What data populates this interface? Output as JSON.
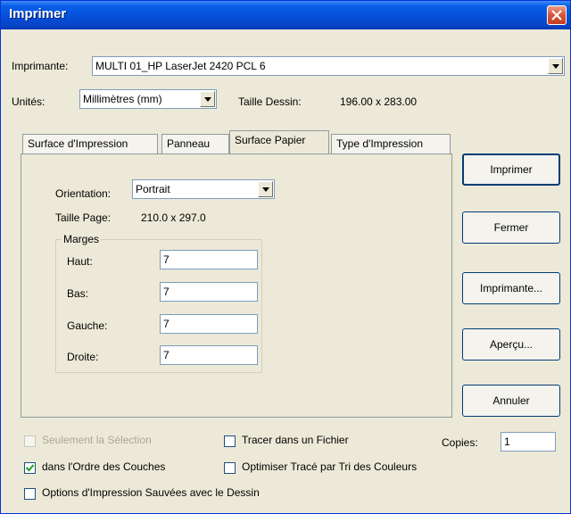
{
  "window": {
    "title": "Imprimer"
  },
  "printer": {
    "label": "Imprimante:",
    "value": "MULTI 01_HP LaserJet 2420 PCL 6"
  },
  "units": {
    "label": "Unités:",
    "value": "Millimètres (mm)"
  },
  "drawing_size": {
    "label": "Taille Dessin:",
    "value": "196.00 x 283.00"
  },
  "tabs": [
    {
      "label": "Surface d'Impression"
    },
    {
      "label": "Panneau"
    },
    {
      "label": "Surface Papier"
    },
    {
      "label": "Type d'Impression"
    }
  ],
  "paper": {
    "orientation_label": "Orientation:",
    "orientation_value": "Portrait",
    "page_size_label": "Taille Page:",
    "page_size_value": "210.0 x 297.0",
    "margins_title": "Marges",
    "margins": [
      {
        "label": "Haut:",
        "value": "7"
      },
      {
        "label": "Bas:",
        "value": "7"
      },
      {
        "label": "Gauche:",
        "value": "7"
      },
      {
        "label": "Droite:",
        "value": "7"
      }
    ]
  },
  "buttons": {
    "print": "Imprimer",
    "close": "Fermer",
    "printer": "Imprimante...",
    "preview": "Aperçu...",
    "cancel": "Annuler"
  },
  "options": {
    "selection_only": "Seulement la Sélection",
    "plot_to_file": "Tracer dans un Fichier",
    "layer_order": "dans l'Ordre des Couches",
    "optimize_plot": "Optimiser Tracé par Tri des Couleurs",
    "saved_options": "Options d'Impression Sauvées avec le Dessin"
  },
  "copies": {
    "label": "Copies:",
    "value": "1"
  },
  "colors": {
    "titlebar": "#0550d9",
    "dialog_bg": "#ece9d8",
    "button_border": "#003c74"
  }
}
